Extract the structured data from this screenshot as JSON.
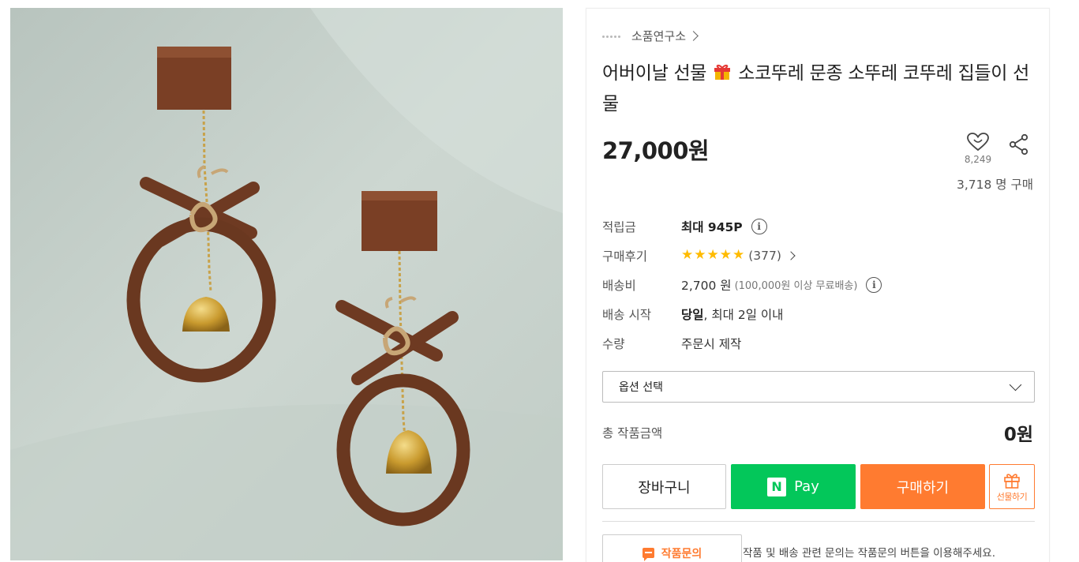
{
  "product_image": {
    "alt": "wooden bell wind chime ornaments"
  },
  "seller": {
    "name": "소품연구소"
  },
  "product": {
    "title_part1": "어버이날 선물",
    "title_part2": "소코뚜레 문종 소뚜레 코뚜레 집들이 선물",
    "price": "27,000원"
  },
  "like": {
    "count": "8,249",
    "icon": "heart-icon"
  },
  "share": {
    "icon": "share-icon"
  },
  "purchase_count": "3,718 명 구매",
  "info": {
    "points": {
      "label": "적립금",
      "value": "최대 945P"
    },
    "reviews": {
      "label": "구매후기",
      "stars": 5,
      "count": "(377)"
    },
    "shipping": {
      "label": "배송비",
      "value": "2,700 원",
      "note": "(100,000원 이상 무료배송)"
    },
    "ship_start": {
      "label": "배송 시작",
      "value_bold": "당일",
      "value_rest": ", 최대 2일 이내"
    },
    "quantity": {
      "label": "수량",
      "value": "주문시 제작"
    }
  },
  "option_select": {
    "label": "옵션 선택"
  },
  "total": {
    "label": "총 작품금액",
    "value": "0원"
  },
  "buttons": {
    "cart": "장바구니",
    "npay": "Pay",
    "npay_logo": "N",
    "buy": "구매하기",
    "gift": "선물하기"
  },
  "inquiry": {
    "button": "작품문의",
    "text": "작품 및 배송 관련 문의는 작품문의 버튼을 이용해주세요."
  },
  "colors": {
    "accent": "#ff7b30",
    "npay": "#03c75a",
    "star": "#ffbb00"
  }
}
